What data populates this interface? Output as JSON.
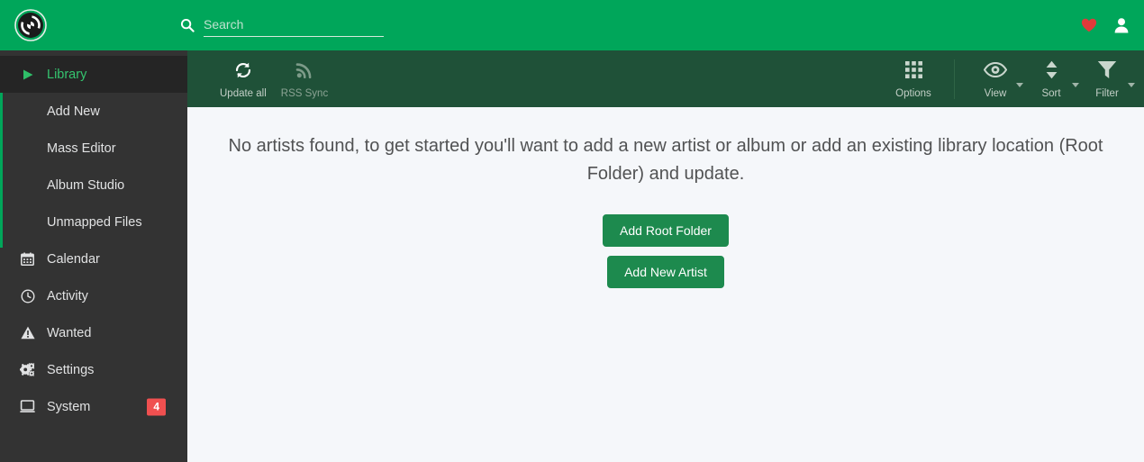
{
  "header": {
    "logo_icon": "lidarr-logo-icon",
    "search": {
      "value": "",
      "placeholder": "Search",
      "icon": "search-icon"
    },
    "donate_icon": "heart-icon",
    "account_icon": "user-icon",
    "background_color": "#00a65a"
  },
  "sidebar": {
    "background_color": "#333333",
    "accent_color": "#00a65a",
    "items": [
      {
        "label": "Library",
        "icon": "play-icon",
        "active": true
      },
      {
        "label": "Add New",
        "icon": "",
        "sub": true
      },
      {
        "label": "Mass Editor",
        "icon": "",
        "sub": true
      },
      {
        "label": "Album Studio",
        "icon": "",
        "sub": true
      },
      {
        "label": "Unmapped Files",
        "icon": "",
        "sub": true
      },
      {
        "label": "Calendar",
        "icon": "calendar-icon",
        "active": false
      },
      {
        "label": "Activity",
        "icon": "clock-icon",
        "active": false
      },
      {
        "label": "Wanted",
        "icon": "warning-icon",
        "active": false
      },
      {
        "label": "Settings",
        "icon": "gears-icon",
        "active": false
      },
      {
        "label": "System",
        "icon": "desktop-icon",
        "active": false,
        "badge": "4"
      }
    ],
    "badge_color": "#f05050"
  },
  "toolbar": {
    "background_color": "#1f5138",
    "left": [
      {
        "label": "Update all",
        "icon": "refresh-icon",
        "disabled": false
      },
      {
        "label": "RSS Sync",
        "icon": "rss-icon",
        "disabled": true
      }
    ],
    "right": [
      {
        "label": "Options",
        "icon": "grid-icon",
        "caret": false
      },
      {
        "label": "View",
        "icon": "eye-icon",
        "caret": true
      },
      {
        "label": "Sort",
        "icon": "sort-icon",
        "caret": true
      },
      {
        "label": "Filter",
        "icon": "filter-icon",
        "caret": true
      }
    ]
  },
  "content": {
    "background_color": "#f5f7fa",
    "message": "No artists found, to get started you'll want to add a new artist or album or add an existing library location (Root Folder) and update.",
    "buttons": [
      {
        "label": "Add Root Folder"
      },
      {
        "label": "Add New Artist"
      }
    ],
    "button_color": "#1d8a4e"
  }
}
